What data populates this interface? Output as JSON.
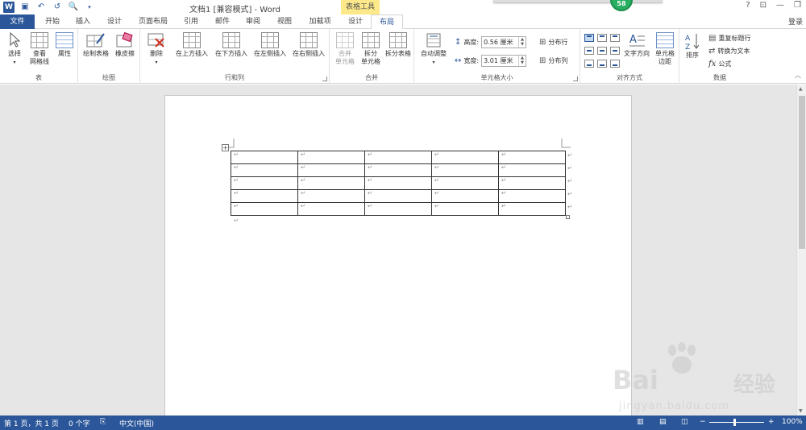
{
  "window": {
    "title": "文档1 [兼容模式] - Word",
    "context_tab_group": "表格工具",
    "notification_count": "58",
    "help": "?",
    "login": "登录"
  },
  "tabs": [
    {
      "label": "文件"
    },
    {
      "label": "开始"
    },
    {
      "label": "插入"
    },
    {
      "label": "设计"
    },
    {
      "label": "页面布局"
    },
    {
      "label": "引用"
    },
    {
      "label": "邮件"
    },
    {
      "label": "审阅"
    },
    {
      "label": "视图"
    },
    {
      "label": "加载项"
    },
    {
      "label": "设计"
    },
    {
      "label": "布局"
    }
  ],
  "ribbon": {
    "table": {
      "label": "表",
      "select": "选择",
      "gridlines_line1": "查看",
      "gridlines_line2": "网格线",
      "properties": "属性"
    },
    "draw": {
      "label": "绘图",
      "draw_table": "绘制表格",
      "eraser": "橡皮擦"
    },
    "rows_cols": {
      "label": "行和列",
      "delete": "删除",
      "insert_above": "在上方插入",
      "insert_below": "在下方插入",
      "insert_left": "在左侧插入",
      "insert_right": "在右侧插入"
    },
    "merge": {
      "label": "合并",
      "merge_line1": "合并",
      "merge_line2": "单元格",
      "split_line1": "拆分",
      "split_line2": "单元格",
      "split_table": "拆分表格"
    },
    "cell_size": {
      "label": "单元格大小",
      "autofit": "自动调整",
      "height_label": "高度:",
      "height_value": "0.56 厘米",
      "width_label": "宽度:",
      "width_value": "3.01 厘米",
      "distribute_rows": "分布行",
      "distribute_cols": "分布列"
    },
    "alignment": {
      "label": "对齐方式",
      "text_direction": "文字方向",
      "margins_line1": "单元格",
      "margins_line2": "边距"
    },
    "data": {
      "label": "数据",
      "sort": "排序",
      "repeat_header": "重复标题行",
      "convert_text": "转换为文本",
      "formula": "公式"
    }
  },
  "document": {
    "paragraph_mark": "↵",
    "table": {
      "rows": 5,
      "cols": 5
    }
  },
  "statusbar": {
    "page": "第 1 页，共 1 页",
    "words": "0 个字",
    "language": "中文(中国)",
    "zoom": "100%",
    "zoom_level": 1.0
  },
  "watermark": {
    "brand": "Bai",
    "brand_cn": "经验",
    "url": "jingyan.baidu.com"
  },
  "colors": {
    "accent": "#2b579a",
    "context_tab": "#fde98a",
    "badge": "#27ae60"
  }
}
